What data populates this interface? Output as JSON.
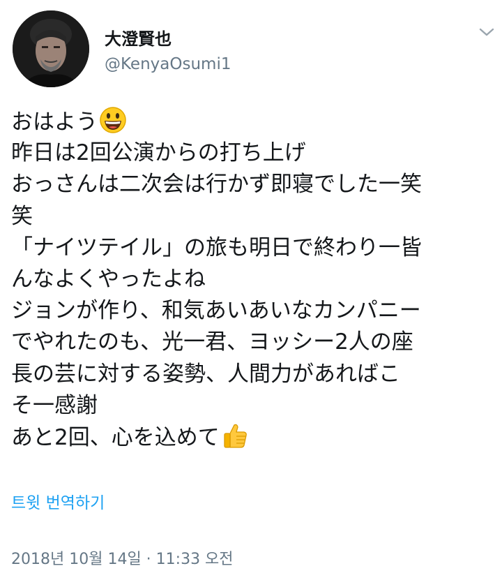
{
  "user": {
    "display_name": "大澄賢也",
    "handle": "@KenyaOsumi1",
    "avatar_icon": "profile-photo"
  },
  "menu": {
    "icon": "chevron-down-icon"
  },
  "tweet": {
    "lines": [
      "おはよう",
      "昨日は2回公演からの打ち上げ",
      "おっさんは二次会は行かず即寝でした一笑",
      "笑",
      "「ナイツテイル」の旅も明日で終わり一皆",
      "んなよくやったよね",
      "ジョンが作り、和気あいあいなカンパニー",
      "でやれたのも、光一君、ヨッシー2人の座",
      "長の芸に対する姿勢、人間力があればこ",
      "そ一感謝",
      "あと2回、心を込めて"
    ],
    "emojis": {
      "line_1": "grinning-face-emoji",
      "line_11": "thumbs-up-emoji"
    }
  },
  "translate_link": "트윗 번역하기",
  "timestamp": "2018년 10월 14일 · 11:33 오전",
  "colors": {
    "text": "#14171a",
    "secondary": "#657786",
    "link": "#1da1f2"
  }
}
